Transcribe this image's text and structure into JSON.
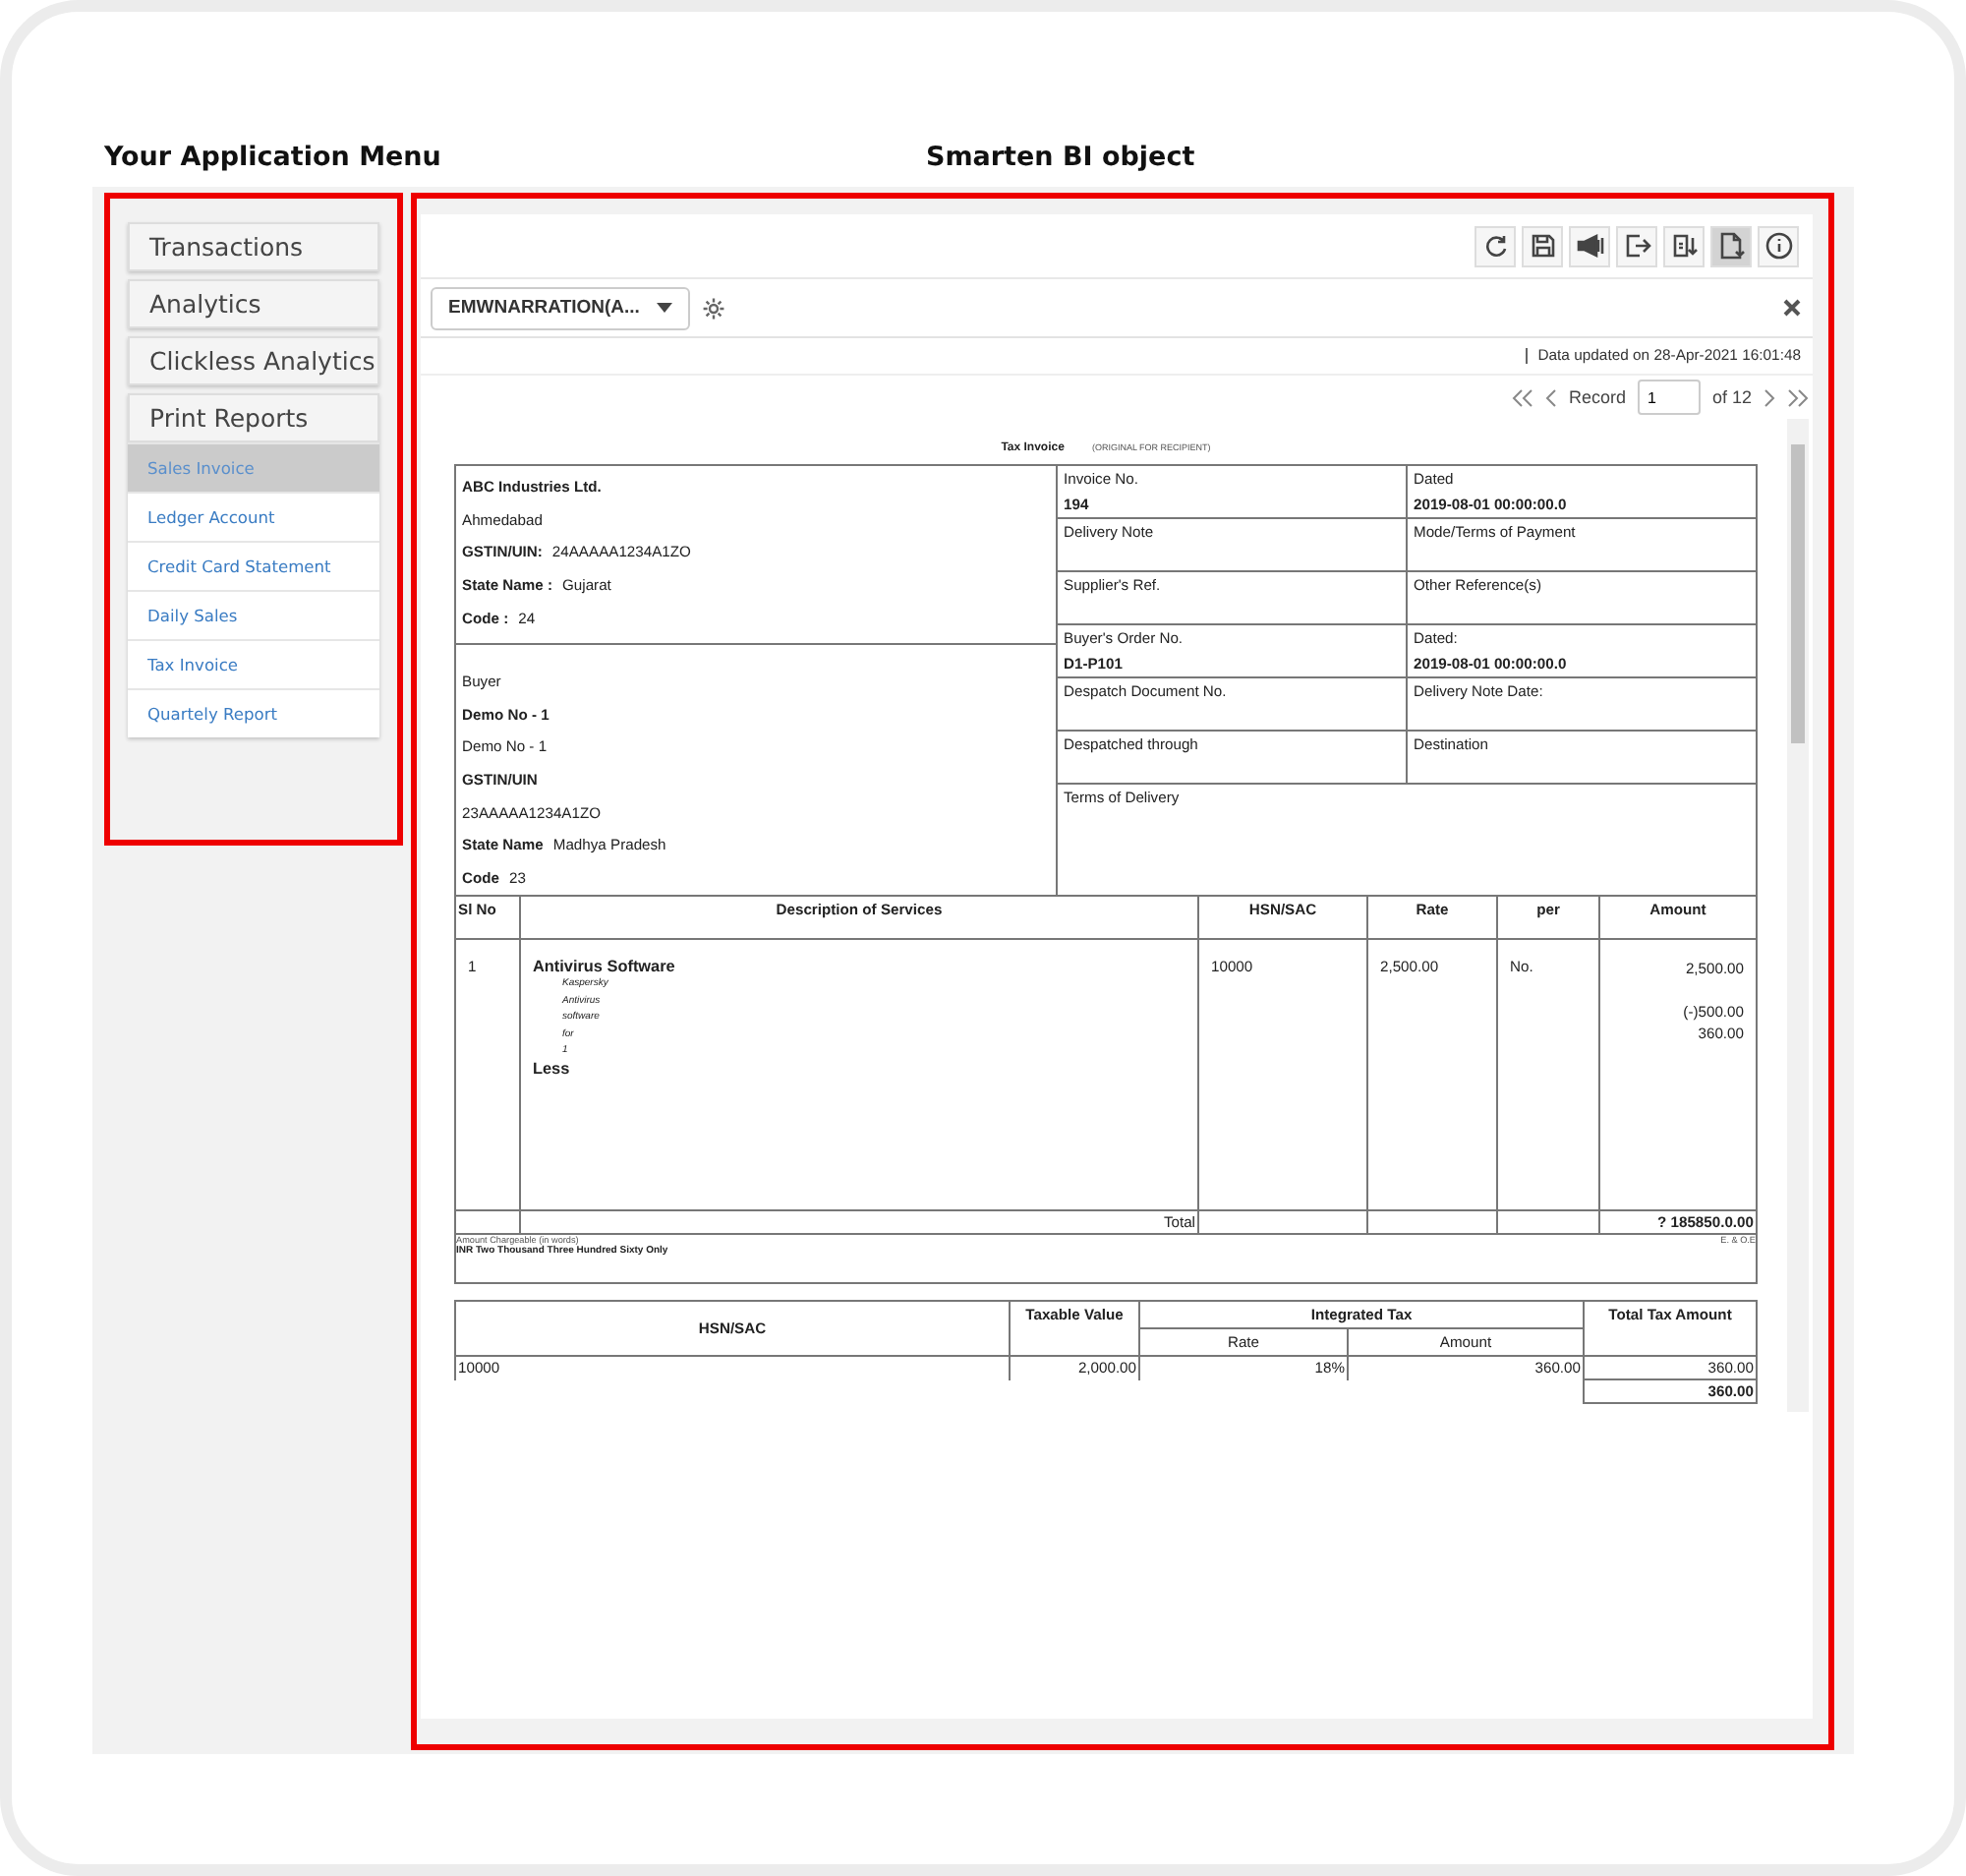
{
  "headings": {
    "menu": "Your Application Menu",
    "object": "Smarten BI object"
  },
  "menu": [
    {
      "label": "Transactions"
    },
    {
      "label": "Analytics"
    },
    {
      "label": "Clickless Analytics"
    },
    {
      "label": "Print Reports",
      "items": [
        {
          "label": "Sales Invoice",
          "selected": true
        },
        {
          "label": "Ledger Account",
          "selected": false
        },
        {
          "label": "Credit Card Statement",
          "selected": false
        },
        {
          "label": "Daily Sales",
          "selected": false
        },
        {
          "label": "Tax Invoice",
          "selected": false
        },
        {
          "label": "Quartely Report",
          "selected": false
        }
      ]
    }
  ],
  "toolbar": [
    {
      "kind": "refresh",
      "selected": false
    },
    {
      "kind": "save",
      "selected": false
    },
    {
      "kind": "announce",
      "selected": false
    },
    {
      "kind": "export",
      "selected": false
    },
    {
      "kind": "download",
      "selected": false
    },
    {
      "kind": "document",
      "selected": true
    },
    {
      "kind": "info",
      "selected": false
    }
  ],
  "report_selector": {
    "value": "EMWNARRATION(A..."
  },
  "updated": "Data updated on 28-Apr-2021 16:01:48",
  "pager": {
    "label": "Record",
    "value": "1",
    "total": "of 12"
  },
  "invoice": {
    "title": "Tax Invoice",
    "subtitle": "(ORIGINAL FOR RECIPIENT)",
    "seller": [
      {
        "label": "ABC Industries Ltd."
      },
      {
        "value": "Ahmedabad"
      },
      {
        "label": "GSTIN/UIN:",
        "value": "24AAAAA1234A1ZO"
      },
      {
        "label": "State Name :",
        "value": "Gujarat"
      },
      {
        "label": "Code :",
        "value": "24"
      }
    ],
    "buyer": [
      {
        "value": "Buyer"
      },
      {
        "label": "Demo No - 1"
      },
      {
        "value": "Demo No - 1"
      },
      {
        "label": "GSTIN/UIN"
      },
      {
        "value": "23AAAAA1234A1ZO"
      },
      {
        "label": "State Name",
        "value": "Madhya Pradesh"
      },
      {
        "label": "Code",
        "value": "23"
      }
    ],
    "details": [
      [
        {
          "label": "Invoice No.",
          "value": "194"
        },
        {
          "label": "Dated",
          "value": "2019-08-01 00:00:00.0"
        }
      ],
      [
        {
          "label": "Delivery Note"
        },
        {
          "label": "Mode/Terms of Payment"
        }
      ],
      [
        {
          "label": "Supplier's Ref."
        },
        {
          "label": "Other Reference(s)"
        }
      ],
      [
        {
          "label": "Buyer's Order No.",
          "value": "D1-P101"
        },
        {
          "label": "Dated:",
          "value": "2019-08-01 00:00:00.0"
        }
      ],
      [
        {
          "label": "Despatch Document No."
        },
        {
          "label": "Delivery Note Date:"
        }
      ],
      [
        {
          "label": "Despatched through"
        },
        {
          "label": "Destination"
        }
      ],
      [
        {
          "label": "Terms of Delivery"
        }
      ]
    ],
    "columns": [
      "Sl No",
      "Description of Services",
      "HSN/SAC",
      "Rate",
      "per",
      "Amount"
    ],
    "item": {
      "sl": "1",
      "name": "Antivirus Software",
      "narration": [
        "Kaspersky",
        "Antivirus",
        "software",
        "for",
        "1"
      ],
      "less": "Less",
      "hsn": "10000",
      "rate": "2,500.00",
      "per": "No.",
      "amounts": [
        "2,500.00",
        "(-)500.00",
        "360.00"
      ]
    },
    "total_label": "Total",
    "total": "? 185850.0.00",
    "words_label": "Amount Chargeable (in words)",
    "eoe": "E. & O.E",
    "words": "INR Two Thousand Three Hundred Sixty Only",
    "tax_columns": {
      "hsn": "HSN/SAC",
      "taxable": "Taxable Value",
      "group": "Integrated Tax",
      "rate": "Rate",
      "amount": "Amount",
      "total": "Total Tax Amount"
    },
    "tax_row": {
      "hsn": "10000",
      "taxable": "2,000.00",
      "rate": "18%",
      "amount": "360.00",
      "total": "360.00"
    },
    "tax_grand_total": "360.00"
  }
}
